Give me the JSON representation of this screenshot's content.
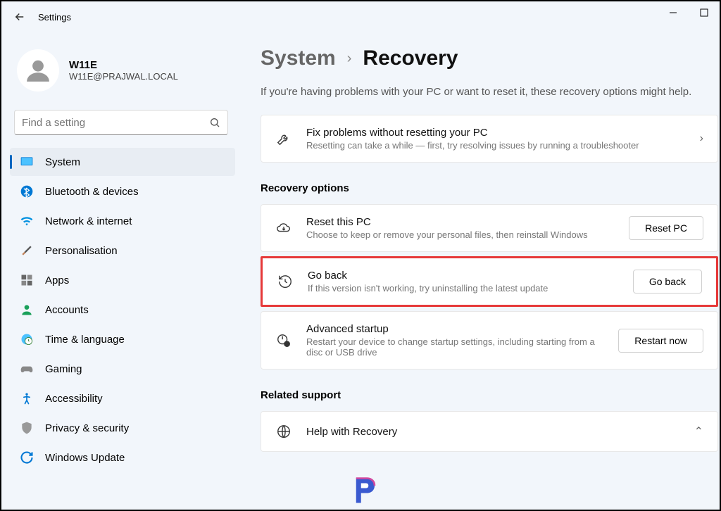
{
  "window": {
    "title": "Settings"
  },
  "user": {
    "name": "W11E",
    "email": "W11E@PRAJWAL.LOCAL"
  },
  "search": {
    "placeholder": "Find a setting"
  },
  "nav": {
    "items": [
      {
        "label": "System"
      },
      {
        "label": "Bluetooth & devices"
      },
      {
        "label": "Network & internet"
      },
      {
        "label": "Personalisation"
      },
      {
        "label": "Apps"
      },
      {
        "label": "Accounts"
      },
      {
        "label": "Time & language"
      },
      {
        "label": "Gaming"
      },
      {
        "label": "Accessibility"
      },
      {
        "label": "Privacy & security"
      },
      {
        "label": "Windows Update"
      }
    ]
  },
  "breadcrumb": {
    "parent": "System",
    "current": "Recovery"
  },
  "subtitle": "If you're having problems with your PC or want to reset it, these recovery options might help.",
  "cards": {
    "fix": {
      "title": "Fix problems without resetting your PC",
      "desc": "Resetting can take a while — first, try resolving issues by running a troubleshooter"
    },
    "reset": {
      "title": "Reset this PC",
      "desc": "Choose to keep or remove your personal files, then reinstall Windows",
      "button": "Reset PC"
    },
    "goback": {
      "title": "Go back",
      "desc": "If this version isn't working, try uninstalling the latest update",
      "button": "Go back"
    },
    "advanced": {
      "title": "Advanced startup",
      "desc": "Restart your device to change startup settings, including starting from a disc or USB drive",
      "button": "Restart now"
    },
    "help": {
      "title": "Help with Recovery"
    }
  },
  "sections": {
    "recovery_options": "Recovery options",
    "related_support": "Related support"
  }
}
